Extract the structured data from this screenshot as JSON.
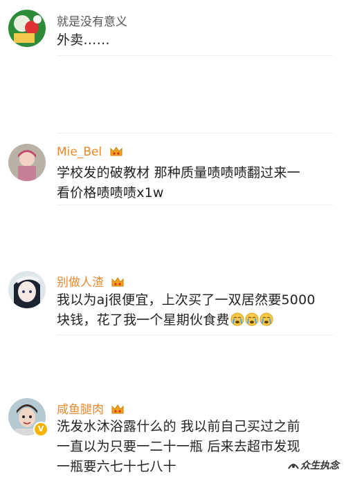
{
  "comments": [
    {
      "username": "就是没有意义",
      "text_lines": [
        "外卖……"
      ],
      "name_color": "#555555"
    },
    {
      "username": "Mie_Bel",
      "text_lines": [
        "学校发的破教材 那种质量啧啧啧翻过来一",
        "看价格啧啧啧x1w"
      ],
      "name_color": "#e8892e",
      "badge": "crown-icon"
    },
    {
      "username": "别做人渣",
      "text_lines": [
        "我以为aj很便宜，上次买了一双居然要5000",
        "块钱，花了我一个星期伙食费"
      ],
      "emojis": [
        "crying-emoji",
        "crying-emoji",
        "crying-emoji"
      ],
      "name_color": "#e8892e",
      "badge": "crown-icon"
    },
    {
      "username": "咸鱼腿肉",
      "text_lines": [
        "洗发水沐浴露什么的 我以前自己买过之前",
        "一直以为只要一二十一瓶 后来去超市发现",
        "一瓶要六七十七八十"
      ],
      "name_color": "#e8892e",
      "badge": "crown-icon",
      "verified": "V"
    }
  ],
  "watermark": "众生执念",
  "colors": {
    "accent": "#e8892e",
    "separator": "#ededed",
    "verified": "#f4b400"
  }
}
